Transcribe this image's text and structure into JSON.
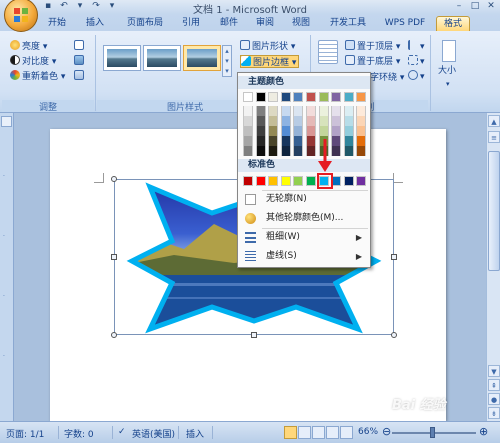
{
  "window": {
    "title": "文档 1 - Microsoft Word"
  },
  "tabs": [
    {
      "label": "开始"
    },
    {
      "label": "插入"
    },
    {
      "label": "页面布局"
    },
    {
      "label": "引用"
    },
    {
      "label": "邮件"
    },
    {
      "label": "审阅"
    },
    {
      "label": "视图"
    },
    {
      "label": "开发工具"
    },
    {
      "label": "WPS PDF"
    },
    {
      "label": "格式",
      "active": true
    }
  ],
  "ribbon": {
    "adjust": {
      "brightness": "亮度",
      "contrast": "对比度",
      "recolor": "重新着色",
      "group_label": "调整"
    },
    "picture_styles": {
      "group_label": "图片样式",
      "shape_label": "图片形状",
      "border_label": "图片边框"
    },
    "arrange": {
      "bring_front": "置于顶层",
      "send_back": "置于底层",
      "text_wrap": "字环绕",
      "group_label": "列"
    },
    "size": {
      "label": "大小"
    }
  },
  "border_menu": {
    "theme_colors_label": "主题颜色",
    "standard_colors_label": "标准色",
    "theme_top_row": [
      "#ffffff",
      "#000000",
      "#eeece1",
      "#1f497d",
      "#4f81bd",
      "#c0504d",
      "#9bbb59",
      "#8064a2",
      "#4bacc6",
      "#f79646"
    ],
    "theme_shades": [
      [
        "#f2f2f2",
        "#7f7f7f",
        "#ddd9c3",
        "#c6d9f0",
        "#dbe5f1",
        "#f2dcdb",
        "#ebf1dd",
        "#e5e0ec",
        "#dbeef3",
        "#fdeada"
      ],
      [
        "#d8d8d8",
        "#595959",
        "#c4bd97",
        "#8db3e2",
        "#b8cce4",
        "#e5b9b7",
        "#d7e3bc",
        "#ccc1d9",
        "#b7dde8",
        "#fbd5b5"
      ],
      [
        "#bfbfbf",
        "#3f3f3f",
        "#938953",
        "#548dd4",
        "#95b3d7",
        "#d99694",
        "#c3d69b",
        "#b2a2c7",
        "#92cddc",
        "#fac08f"
      ],
      [
        "#a5a5a5",
        "#262626",
        "#494429",
        "#17365d",
        "#366092",
        "#953734",
        "#76923c",
        "#5f497a",
        "#31859b",
        "#e36c09"
      ],
      [
        "#7f7f7f",
        "#0c0c0c",
        "#1d1b10",
        "#0f243e",
        "#244061",
        "#632423",
        "#4f6128",
        "#3f3151",
        "#205867",
        "#974806"
      ]
    ],
    "standard_colors": [
      "#c00000",
      "#ff0000",
      "#ffc000",
      "#ffff00",
      "#92d050",
      "#00b050",
      "#00b0f0",
      "#0070c0",
      "#002060",
      "#7030a0"
    ],
    "selected_standard_index": 6,
    "items": [
      {
        "label": "无轮廓(N)",
        "icon": "no-outline-icon"
      },
      {
        "label": "其他轮廓颜色(M)...",
        "icon": "palette-icon"
      },
      {
        "label": "粗细(W)",
        "icon": "line-weight-icon",
        "submenu": true
      },
      {
        "label": "虚线(S)",
        "icon": "dash-icon",
        "submenu": true
      }
    ]
  },
  "document": {
    "picture_shape": "star",
    "border_color": "#00b0f0"
  },
  "status_bar": {
    "page": "页面: 1/1",
    "words": "字数: 0",
    "language": "英语(美国)",
    "insert_mode": "插入",
    "zoom": "66%"
  },
  "watermark": "Bai 经验"
}
